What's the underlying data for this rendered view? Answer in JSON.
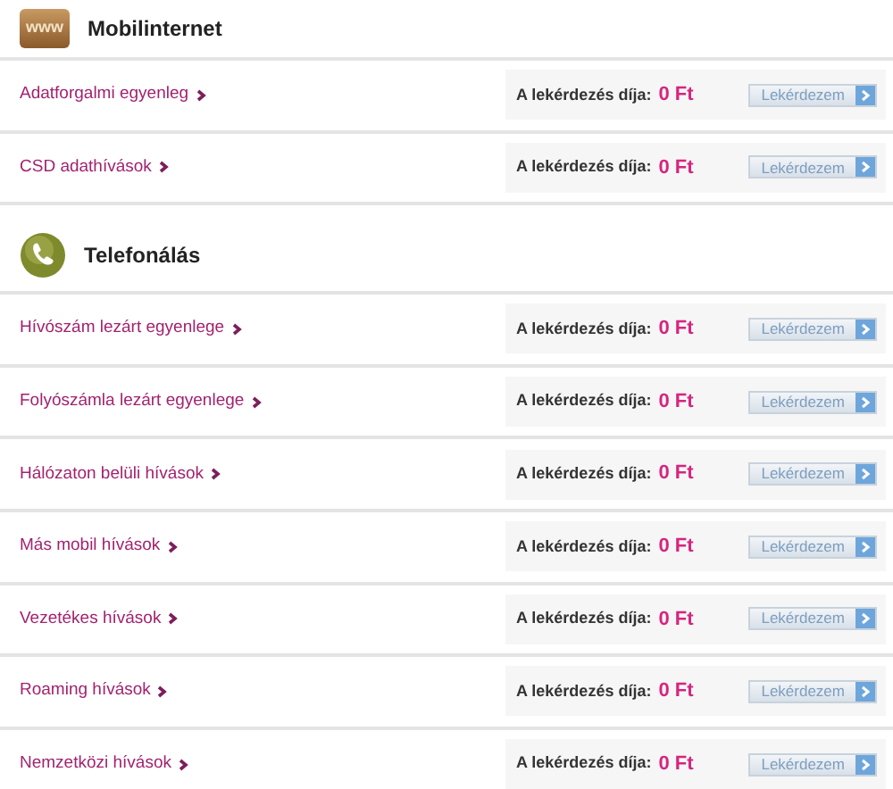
{
  "sections": [
    {
      "kind": "internet",
      "icon_text": "www",
      "title": "Mobilinternet",
      "rows": [
        {
          "label": "Adatforgalmi egyenleg",
          "fee_label": "A lekérdezés díja:",
          "fee": "0 Ft",
          "button": "Lekérdezem"
        },
        {
          "label": "CSD adathívások",
          "fee_label": "A lekérdezés díja:",
          "fee": "0 Ft",
          "button": "Lekérdezem"
        }
      ]
    },
    {
      "kind": "phone",
      "title": "Telefonálás",
      "rows": [
        {
          "label": "Hívószám lezárt egyenlege",
          "fee_label": "A lekérdezés díja:",
          "fee": "0 Ft",
          "button": "Lekérdezem"
        },
        {
          "label": "Folyószámla lezárt egyenlege",
          "fee_label": "A lekérdezés díja:",
          "fee": "0 Ft",
          "button": "Lekérdezem"
        },
        {
          "label": "Hálózaton belüli hívások",
          "fee_label": "A lekérdezés díja:",
          "fee": "0 Ft",
          "button": "Lekérdezem"
        },
        {
          "label": "Más mobil hívások",
          "fee_label": "A lekérdezés díja:",
          "fee": "0 Ft",
          "button": "Lekérdezem"
        },
        {
          "label": "Vezetékes hívások",
          "fee_label": "A lekérdezés díja:",
          "fee": "0 Ft",
          "button": "Lekérdezem"
        },
        {
          "label": "Roaming hívások",
          "fee_label": "A lekérdezés díja:",
          "fee": "0 Ft",
          "button": "Lekérdezem"
        },
        {
          "label": "Nemzetközi hívások",
          "fee_label": "A lekérdezés díja:",
          "fee": "0 Ft",
          "button": "Lekérdezem"
        }
      ]
    }
  ]
}
